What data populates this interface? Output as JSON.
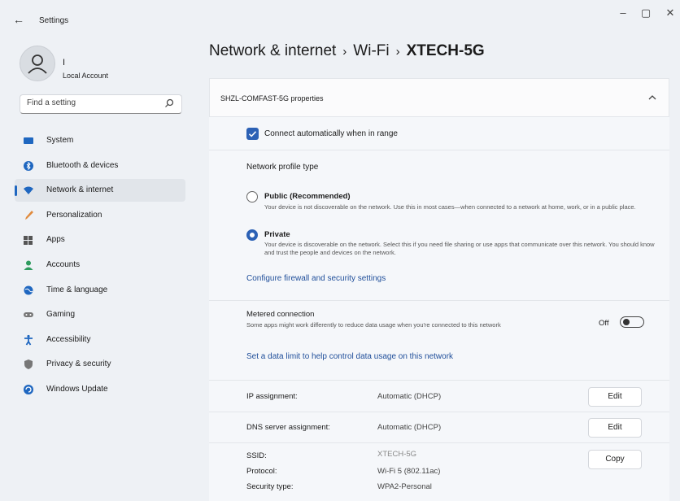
{
  "window": {
    "title": "Settings",
    "back_glyph": "←",
    "controls": {
      "minimize": "–",
      "maximize": "▢",
      "close": "✕"
    }
  },
  "user": {
    "name": "I",
    "account": "Local Account"
  },
  "search": {
    "placeholder": "Find a setting"
  },
  "nav": {
    "items": [
      {
        "label": "System",
        "icon": "system-icon",
        "color": "#1f67c0"
      },
      {
        "label": "Bluetooth & devices",
        "icon": "bluetooth-icon",
        "color": "#1f67c0"
      },
      {
        "label": "Network & internet",
        "icon": "wifi-icon",
        "color": "#1f67c0",
        "active": true
      },
      {
        "label": "Personalization",
        "icon": "brush-icon",
        "color": "#e08a3c"
      },
      {
        "label": "Apps",
        "icon": "apps-icon",
        "color": "#555"
      },
      {
        "label": "Accounts",
        "icon": "accounts-icon",
        "color": "#2e9b5e"
      },
      {
        "label": "Time & language",
        "icon": "globe-icon",
        "color": "#1f67c0"
      },
      {
        "label": "Gaming",
        "icon": "gamepad-icon",
        "color": "#777"
      },
      {
        "label": "Accessibility",
        "icon": "accessibility-icon",
        "color": "#1f67c0"
      },
      {
        "label": "Privacy & security",
        "icon": "shield-icon",
        "color": "#777"
      },
      {
        "label": "Windows Update",
        "icon": "update-icon",
        "color": "#1f67c0"
      }
    ]
  },
  "breadcrumb": {
    "part1": "Network & internet",
    "sep1": "›",
    "part2": "Wi-Fi",
    "sep2": "›",
    "current": "XTECH-5G"
  },
  "properties": {
    "header": "SHZL-COMFAST-5G properties",
    "connect_auto": {
      "label": "Connect automatically when in range",
      "checked": true
    },
    "profile": {
      "title": "Network profile type",
      "public": {
        "label": "Public (Recommended)",
        "desc": "Your device is not discoverable on the network. Use this in most cases—when connected to a network at home, work, or in a public place."
      },
      "private": {
        "label": "Private",
        "desc": "Your device is discoverable on the network. Select this if you need file sharing or use apps that communicate over this network. You should know and trust the people and devices on the network."
      },
      "selected": "private",
      "firewall_link": "Configure firewall and security settings"
    },
    "metered": {
      "title": "Metered connection",
      "desc": "Some apps might work differently to reduce data usage when you're connected to this network",
      "state": "Off",
      "data_limit_link": "Set a data limit to help control data usage on this network"
    },
    "ip": {
      "label": "IP assignment:",
      "value": "Automatic (DHCP)",
      "button": "Edit"
    },
    "dns": {
      "label": "DNS server assignment:",
      "value": "Automatic (DHCP)",
      "button": "Edit"
    },
    "info": {
      "rows": [
        {
          "label": "SSID:",
          "value": "XTECH-5G"
        },
        {
          "label": "Protocol:",
          "value": "Wi-Fi 5 (802.11ac)"
        },
        {
          "label": "Security type:",
          "value": "WPA2-Personal"
        }
      ],
      "copy_button": "Copy"
    }
  },
  "colors": {
    "accent": "#2c61b5",
    "link": "#1f4e9a",
    "page_bg": "#eef1f5"
  }
}
